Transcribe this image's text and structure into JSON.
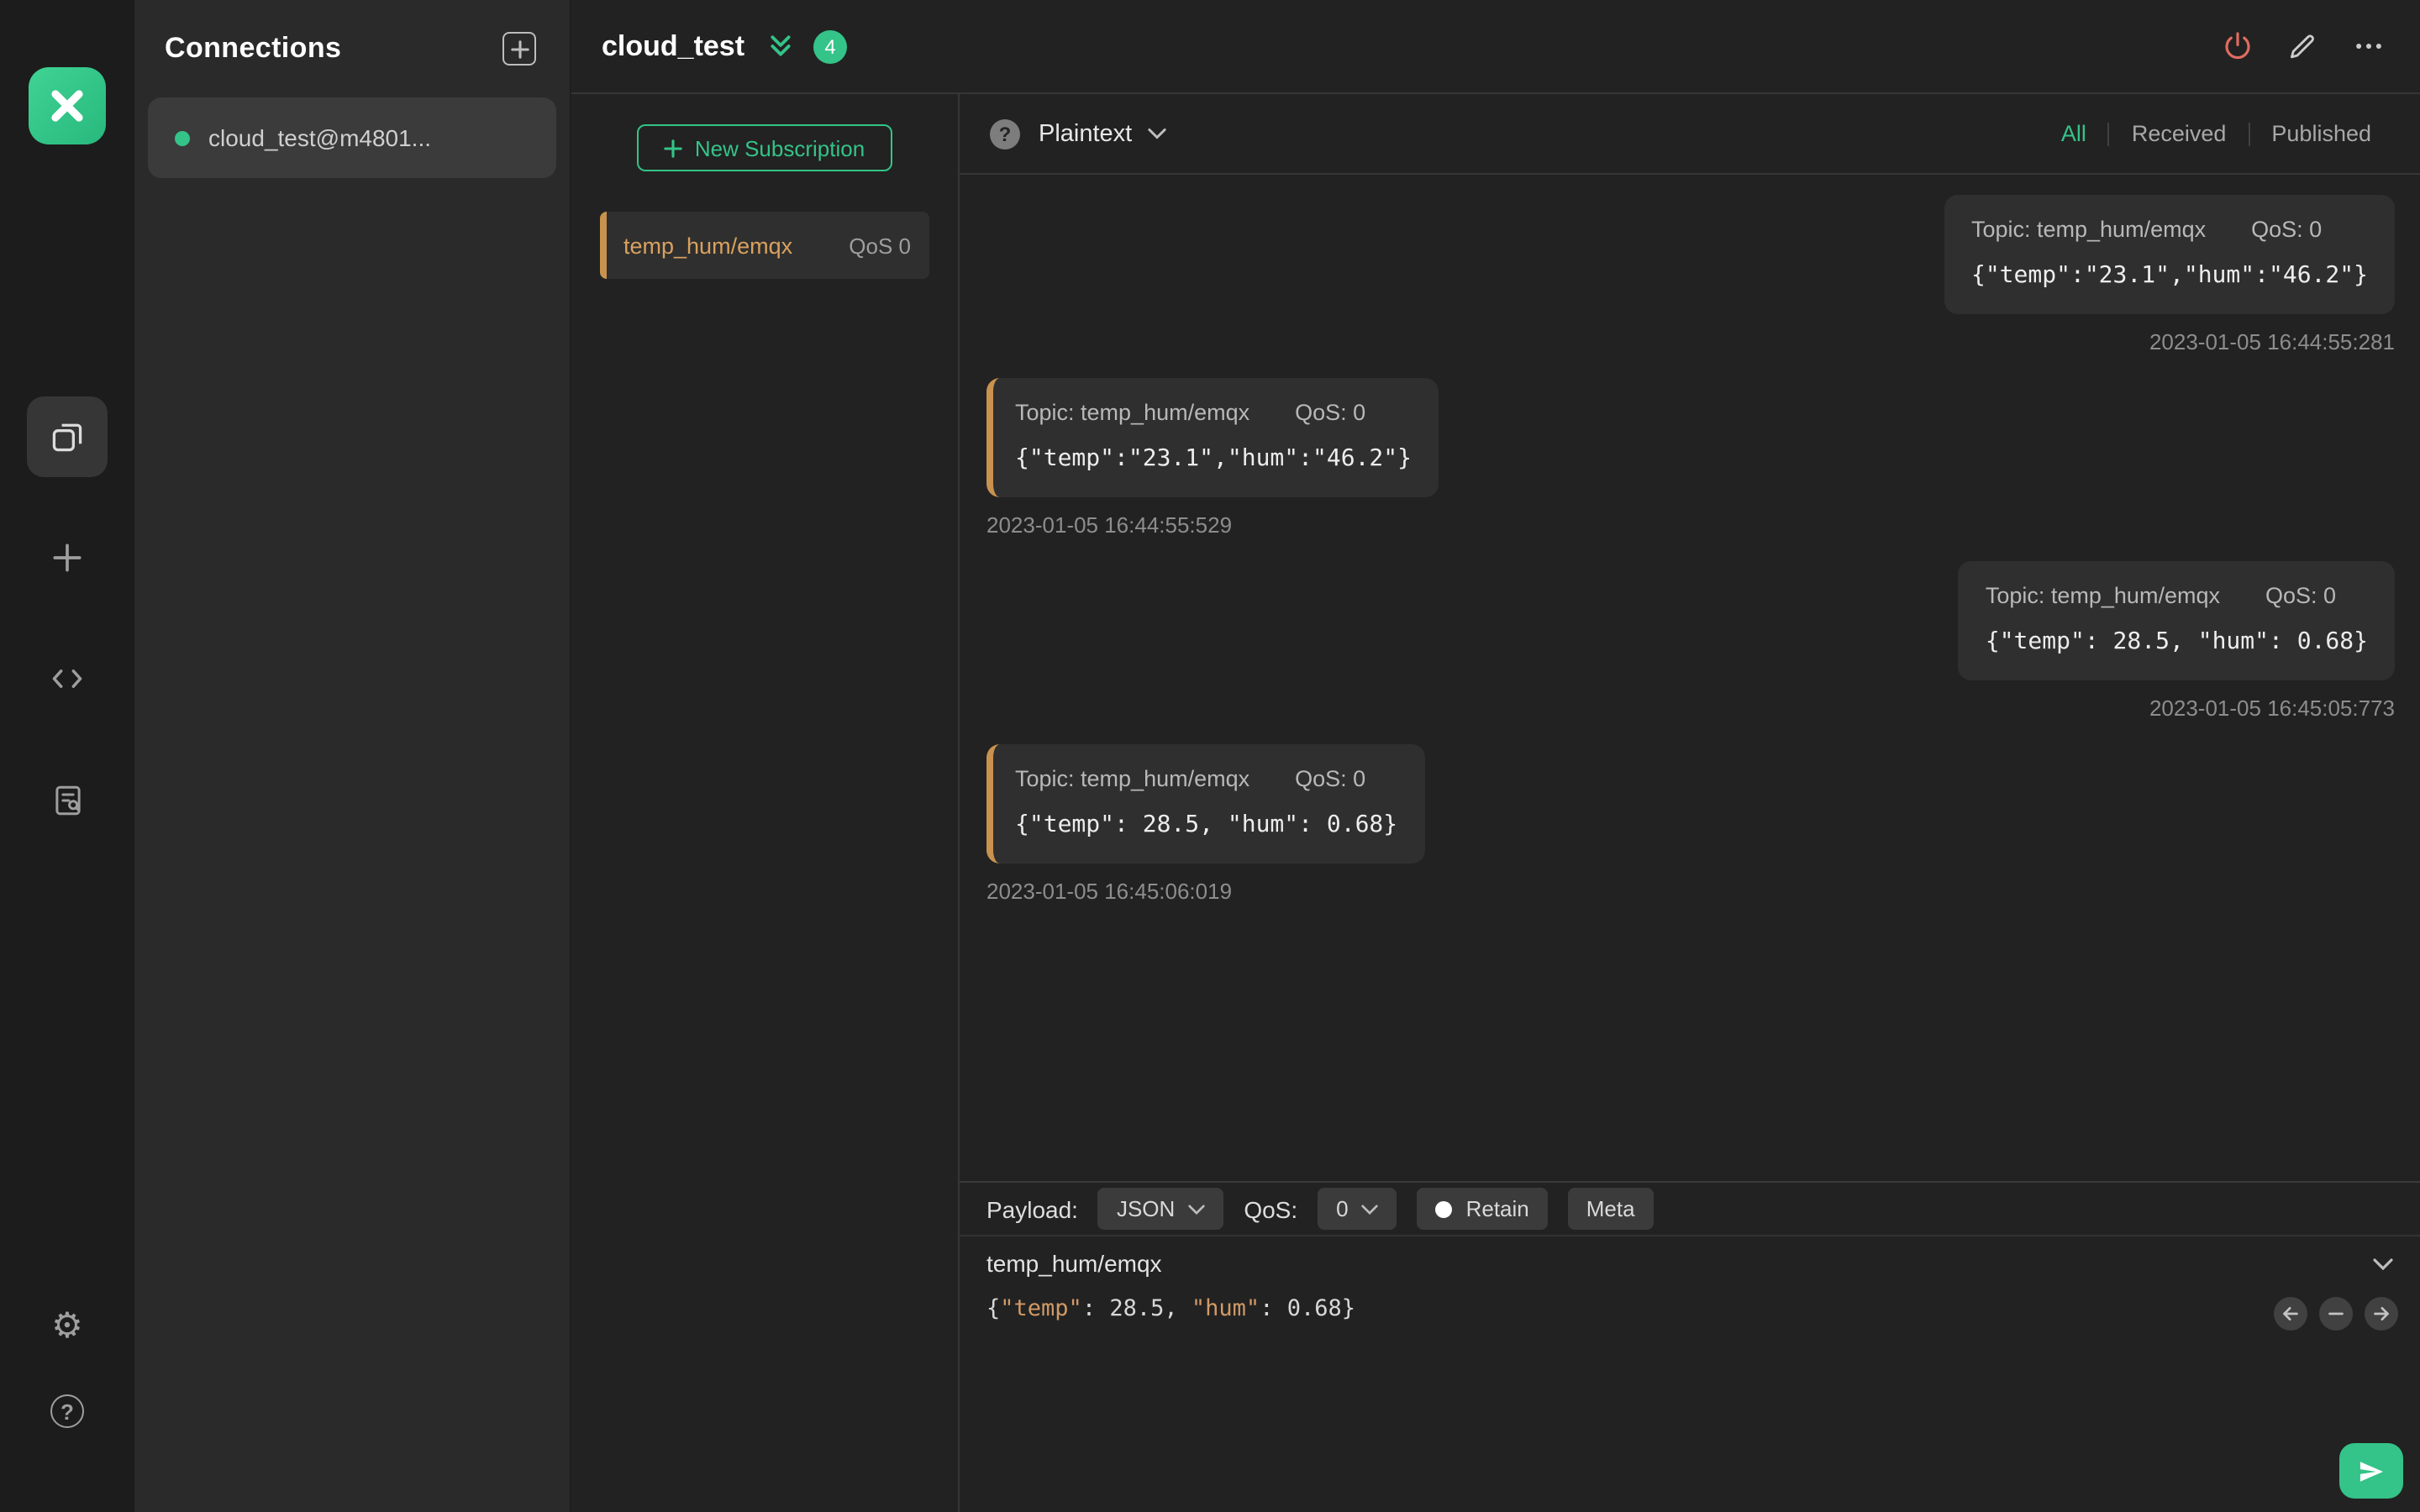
{
  "colors": {
    "accent_green": "#34c388",
    "topic_orange": "#d9a15f",
    "power_red": "#e06c60"
  },
  "connections_panel": {
    "title": "Connections",
    "items": [
      {
        "name": "cloud_test@m4801...",
        "status": "connected"
      }
    ]
  },
  "header": {
    "title": "cloud_test",
    "badge_count": "4"
  },
  "subscriptions": {
    "new_button_label": "New Subscription",
    "items": [
      {
        "topic": "temp_hum/emqx",
        "qos": "QoS 0"
      }
    ]
  },
  "toolbar": {
    "format": "Plaintext",
    "filters": {
      "all": "All",
      "received": "Received",
      "published": "Published"
    },
    "active_filter": "All"
  },
  "messages": [
    {
      "direction": "published",
      "topic": "Topic: temp_hum/emqx",
      "qos": "QoS: 0",
      "payload": "{\"temp\":\"23.1\",\"hum\":\"46.2\"}",
      "timestamp": "2023-01-05 16:44:55:281"
    },
    {
      "direction": "received",
      "topic": "Topic: temp_hum/emqx",
      "qos": "QoS: 0",
      "payload": "{\"temp\":\"23.1\",\"hum\":\"46.2\"}",
      "timestamp": "2023-01-05 16:44:55:529"
    },
    {
      "direction": "published",
      "topic": "Topic: temp_hum/emqx",
      "qos": "QoS: 0",
      "payload": "{\"temp\": 28.5, \"hum\": 0.68}",
      "timestamp": "2023-01-05 16:45:05:773"
    },
    {
      "direction": "received",
      "topic": "Topic: temp_hum/emqx",
      "qos": "QoS: 0",
      "payload": "{\"temp\": 28.5, \"hum\": 0.68}",
      "timestamp": "2023-01-05 16:45:06:019"
    }
  ],
  "publish": {
    "payload_label": "Payload:",
    "format": "JSON",
    "qos_label": "QoS:",
    "qos_value": "0",
    "retain_label": "Retain",
    "meta_label": "Meta",
    "topic": "temp_hum/emqx",
    "payload": "{\"temp\": 28.5, \"hum\": 0.68}",
    "payload_segments": [
      "{",
      "\"temp\"",
      ": 28.5, ",
      "\"hum\"",
      ": 0.68}"
    ]
  }
}
